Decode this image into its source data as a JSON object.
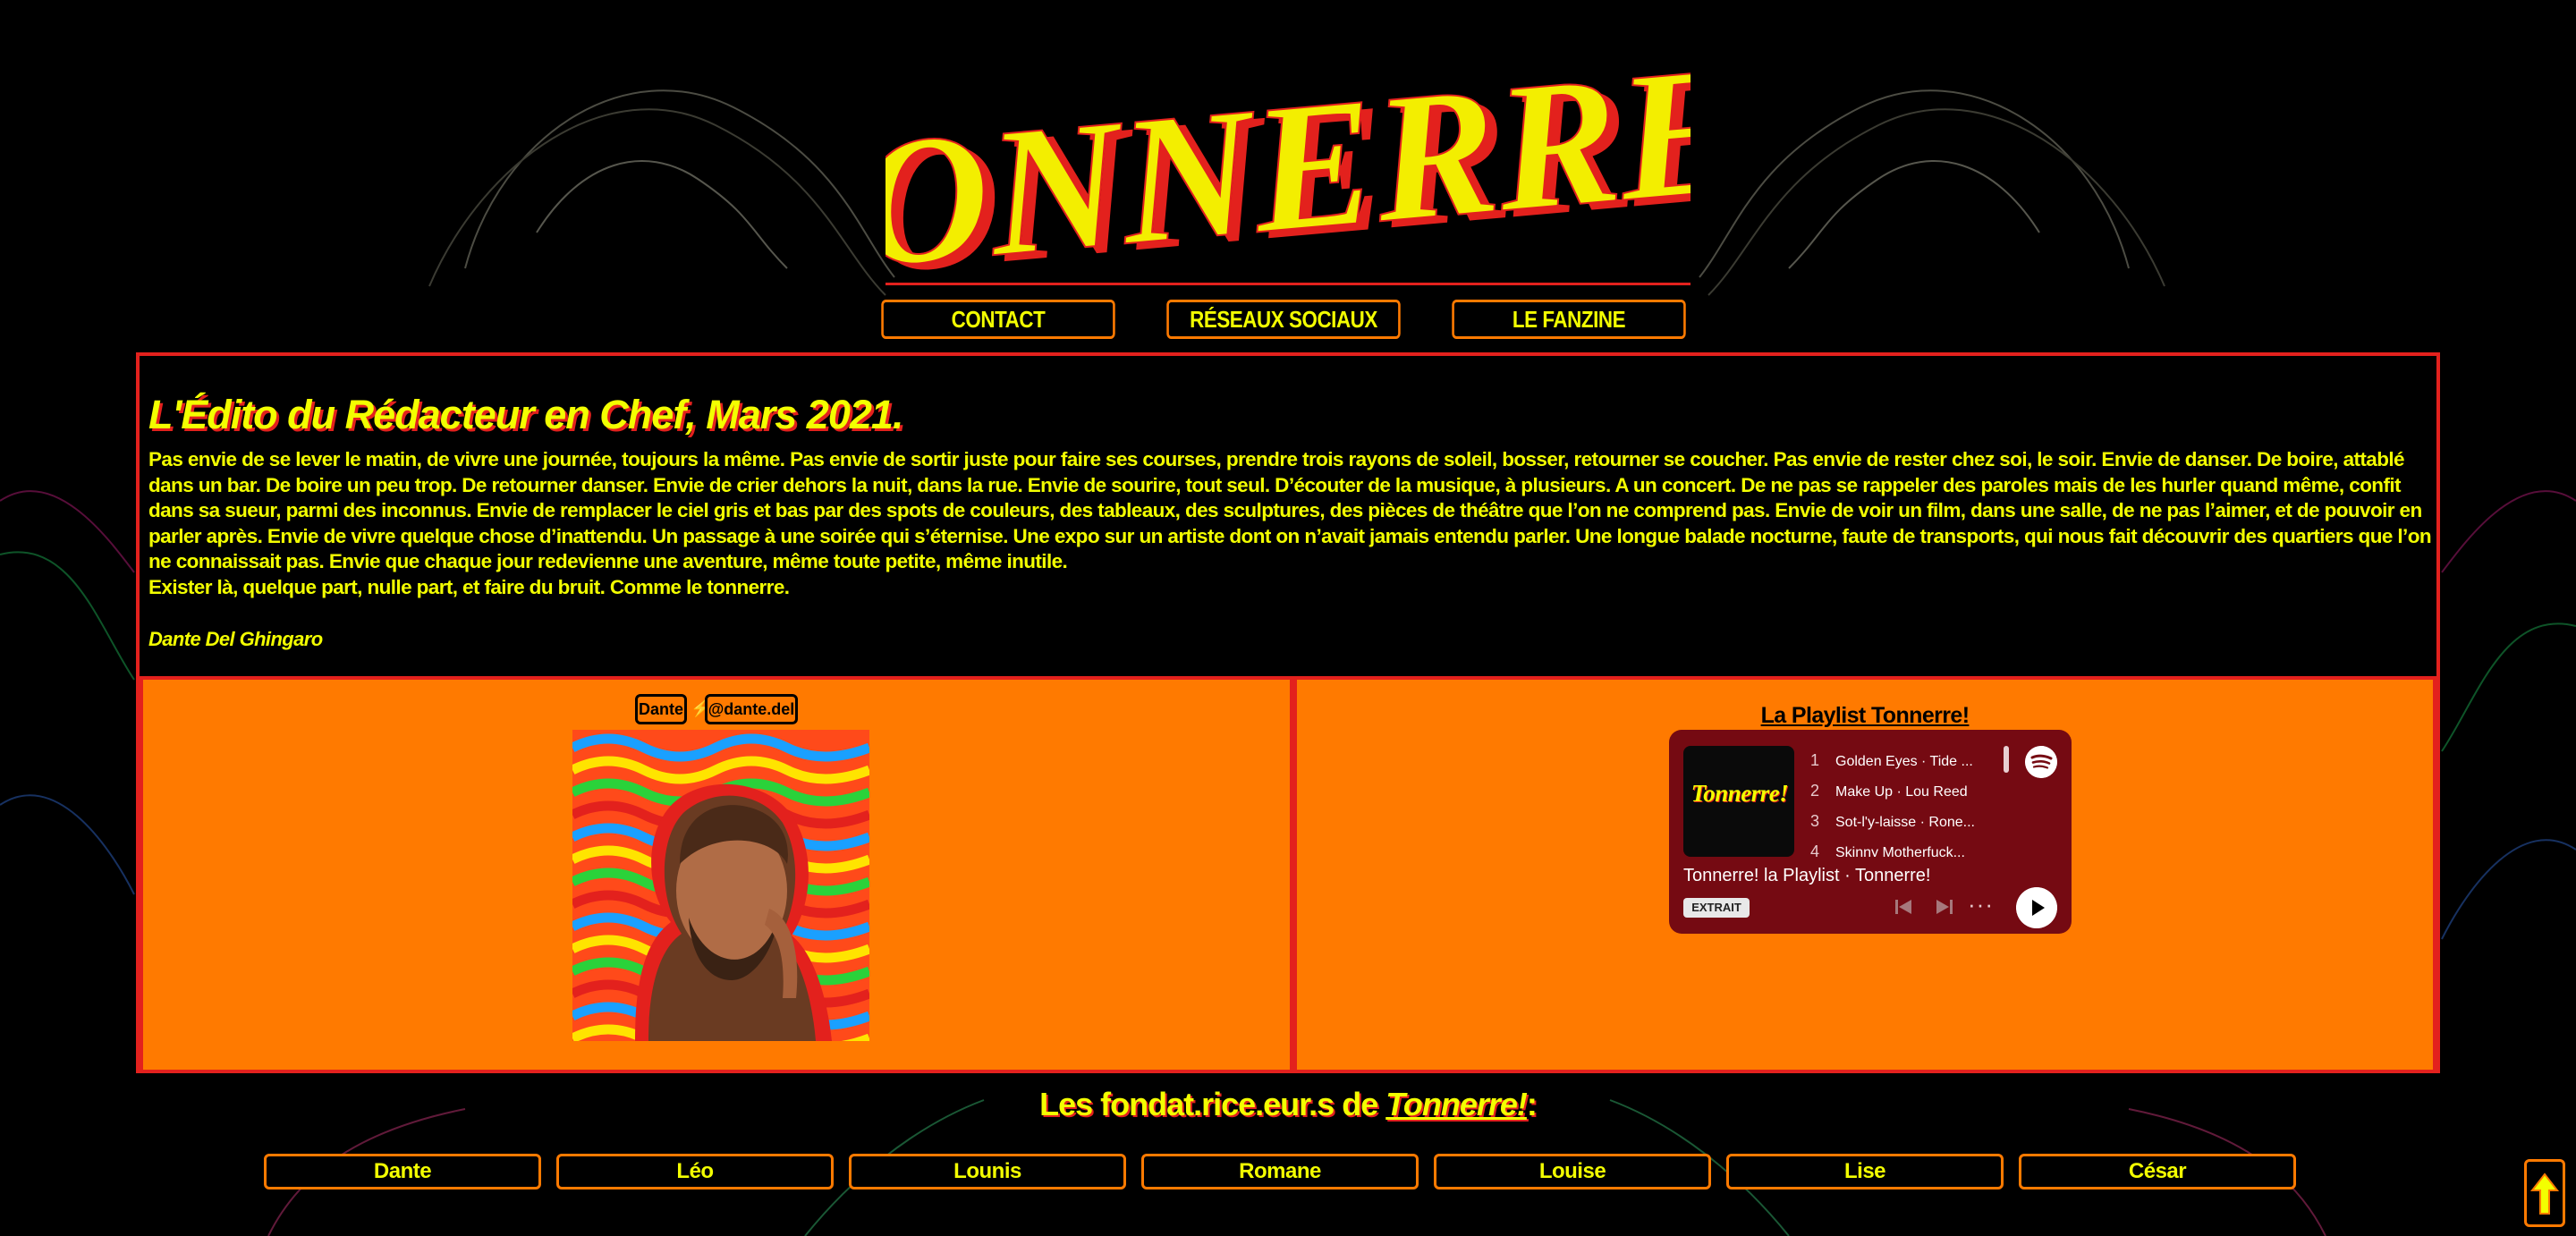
{
  "logo": {
    "text": "Tonnerre!"
  },
  "nav": [
    {
      "label": "CONTACT"
    },
    {
      "label": "RÉSEAUX SOCIAUX"
    },
    {
      "label": "LE FANZINE"
    }
  ],
  "edito": {
    "title": "L'Édito du Rédacteur en Chef, Mars 2021.",
    "paragraphs": [
      "Pas envie de se lever le matin, de vivre une journée, toujours la même. Pas envie de sortir juste pour faire ses courses, prendre trois rayons de soleil, bosser, retourner se coucher. Pas envie de rester chez soi, le soir. Envie de danser. De boire, attablé dans un bar. De boire un peu trop. De retourner danser. Envie de crier dehors la nuit, dans la rue. Envie de sourire, tout seul. D’écouter de la musique, à plusieurs. A un concert. De ne pas se rappeler des paroles mais de les hurler quand même, confit dans sa sueur, parmi des inconnus. Envie de remplacer le ciel gris et bas par des spots de couleurs, des tableaux, des sculptures, des pièces de théâtre que l’on ne comprend pas. Envie de voir un film, dans une salle, de ne pas l’aimer, et de pouvoir en parler après. Envie de vivre quelque chose d’inattendu. Un passage à une soirée qui s’éternise. Une expo sur un artiste dont on n’avait jamais entendu parler. Une longue balade nocturne, faute de transports, qui nous fait découvrir des quartiers que l’on ne connaissait pas. Envie que chaque jour redevienne une aventure, même toute petite, même inutile.",
      "Exister là, quelque part, nulle part, et faire du bruit. Comme le tonnerre."
    ],
    "signature": "Dante Del Ghingaro"
  },
  "author": {
    "name": "Dante",
    "handle": "@dante.del",
    "separator": "⚡"
  },
  "playlist": {
    "title": "La Playlist Tonnerre!",
    "cover_text": "Tonnerre!",
    "tracks": [
      {
        "num": "1",
        "title": "Golden Eyes",
        "artist": "Tide ..."
      },
      {
        "num": "2",
        "title": "Make Up",
        "artist": "Lou Reed"
      },
      {
        "num": "3",
        "title": "Sot-l'y-laisse",
        "artist": "Rone..."
      },
      {
        "num": "4",
        "title": "Skinny Motherfuck...",
        "artist": ""
      }
    ],
    "name": "Tonnerre! la Playlist",
    "owner": "Tonnerre!",
    "badge": "EXTRAIT"
  },
  "founders": {
    "title_prefix": "Les fondat.rice.eur.s de ",
    "title_brand": "Tonnerre!",
    "title_suffix": ":",
    "names": [
      "Dante",
      "Léo",
      "Lounis",
      "Romane",
      "Louise",
      "Lise",
      "César"
    ]
  },
  "colors": {
    "accent_yellow": "#f3ff00",
    "accent_orange": "#ff7a00",
    "accent_red": "#e3211d",
    "spotify_card": "#750a12"
  },
  "icons": [
    "spotify-icon",
    "previous-track-icon",
    "next-track-icon",
    "more-options-icon",
    "play-icon",
    "arrow-up-icon"
  ]
}
